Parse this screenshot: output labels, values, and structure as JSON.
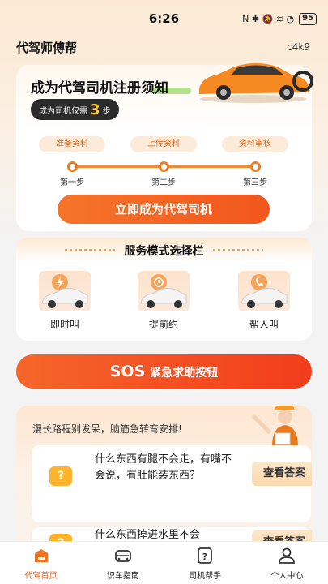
{
  "status_bar": {
    "time": "6:26",
    "icons": "N ✱ 🔕 ≋ ◔",
    "battery": "95"
  },
  "header": {
    "title": "代驾师傅帮",
    "code": "c4k9"
  },
  "register_card": {
    "title": "成为代驾司机注册须知",
    "steps_prefix": "成为司机仅需",
    "steps_count": "3",
    "steps_suffix": "步",
    "steps": [
      {
        "tag": "准备资料",
        "label": "第一步"
      },
      {
        "tag": "上传资料",
        "label": "第二步"
      },
      {
        "tag": "资料审核",
        "label": "第三步"
      }
    ],
    "button_label": "立即成为代驾司机"
  },
  "service": {
    "title": "服务模式选择栏",
    "items": [
      {
        "label": "即时叫",
        "icon": "lightning-icon"
      },
      {
        "label": "提前约",
        "icon": "clock-icon"
      },
      {
        "label": "帮人叫",
        "icon": "phone-icon"
      }
    ]
  },
  "sos": {
    "big": "SOS",
    "small": "紧急求助按钮"
  },
  "riddles": {
    "heading": "漫长路程别发呆，脑筋急转弯安排!",
    "items": [
      {
        "question": "什么东西有腿不会走，有嘴不会说，有肚能装东西？",
        "button": "查看答案"
      },
      {
        "question": "什么东西掉进水里不会",
        "button": "查看答案"
      }
    ]
  },
  "tabbar": {
    "tabs": [
      {
        "label": "代驾首页",
        "icon": "home-icon",
        "active": true
      },
      {
        "label": "识车指南",
        "icon": "car-front-icon",
        "active": false
      },
      {
        "label": "司机帮手",
        "icon": "help-icon",
        "active": false
      },
      {
        "label": "个人中心",
        "icon": "user-icon",
        "active": false
      }
    ]
  },
  "colors": {
    "accent": "#f26a22",
    "sos": "#f2461e",
    "tab_active": "#e8641f"
  }
}
